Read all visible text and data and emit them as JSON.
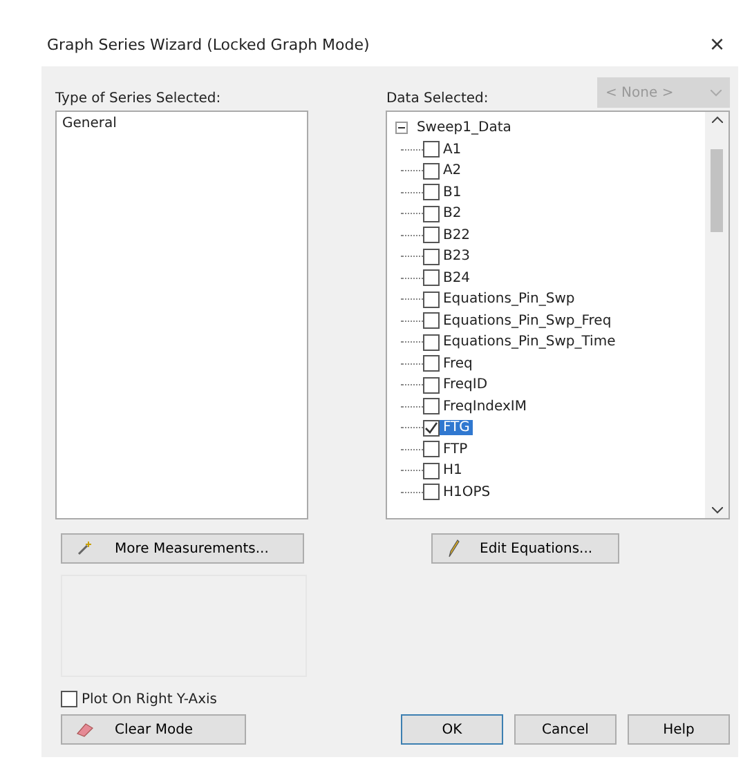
{
  "window": {
    "title": "Graph Series Wizard (Locked Graph Mode)",
    "close": "×"
  },
  "series_type": {
    "label": "Type of Series Selected:",
    "items": [
      {
        "label": "General",
        "selected": false
      }
    ]
  },
  "data": {
    "label": "Data Selected:",
    "dropdown": {
      "value": "< None >",
      "disabled": true
    },
    "tree": [
      {
        "label": "Sweep1_Data",
        "expanded": true,
        "children": [
          {
            "label": "A1",
            "checked": false,
            "selected": false
          },
          {
            "label": "A2",
            "checked": false,
            "selected": false
          },
          {
            "label": "B1",
            "checked": false,
            "selected": false
          },
          {
            "label": "B2",
            "checked": false,
            "selected": false
          },
          {
            "label": "B22",
            "checked": false,
            "selected": false
          },
          {
            "label": "B23",
            "checked": false,
            "selected": false
          },
          {
            "label": "B24",
            "checked": false,
            "selected": false
          },
          {
            "label": "Equations_Pin_Swp",
            "checked": false,
            "selected": false
          },
          {
            "label": "Equations_Pin_Swp_Freq",
            "checked": false,
            "selected": false
          },
          {
            "label": "Equations_Pin_Swp_Time",
            "checked": false,
            "selected": false
          },
          {
            "label": "Freq",
            "checked": false,
            "selected": false
          },
          {
            "label": "FreqID",
            "checked": false,
            "selected": false
          },
          {
            "label": "FreqIndexIM",
            "checked": false,
            "selected": false
          },
          {
            "label": "FTG",
            "checked": true,
            "selected": true
          },
          {
            "label": "FTP",
            "checked": false,
            "selected": false
          },
          {
            "label": "H1",
            "checked": false,
            "selected": false
          },
          {
            "label": "H1OPS",
            "checked": false,
            "selected": false
          }
        ]
      }
    ]
  },
  "more_button": "More Measurements...",
  "edit_button": "Edit Equations...",
  "plot_right": {
    "label": "Plot On Right Y-Axis",
    "checked": false
  },
  "clear_button": "Clear Mode",
  "buttons": [
    {
      "label": "OK",
      "default": true
    },
    {
      "label": "Cancel",
      "default": false
    },
    {
      "label": "Help",
      "default": false
    }
  ]
}
